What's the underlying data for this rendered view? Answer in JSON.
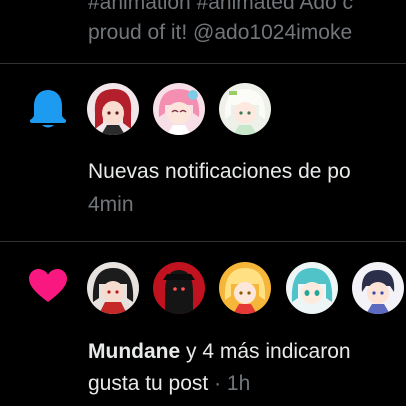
{
  "previous_item": {
    "line1": "#animation #animated Ado c",
    "line2": "proud of it! @ado1024imoke"
  },
  "notifications": [
    {
      "type": "new-posts",
      "icon": "bell-icon",
      "icon_color": "#1d9bf0",
      "text": "Nuevas notificaciones de po",
      "time": "4min",
      "avatars": [
        {
          "name": "red-hair-avatar",
          "bg": "#f1e6ea"
        },
        {
          "name": "pink-hair-avatar",
          "bg": "#f7dfe7"
        },
        {
          "name": "white-hair-avatar",
          "bg": "#eef1ea"
        }
      ]
    },
    {
      "type": "likes",
      "icon": "heart-icon",
      "icon_color": "#f91880",
      "user": "Mundane",
      "action_line1": " y 4 más indicaron",
      "action_line2": "gusta tu post",
      "separator": " · ",
      "time": "1h",
      "avatars": [
        {
          "name": "dark-hair-avatar",
          "bg": "#e8e2df"
        },
        {
          "name": "dark-figure-avatar",
          "bg": "#c1121f"
        },
        {
          "name": "blonde-avatar",
          "bg": "#f6b63a"
        },
        {
          "name": "teal-hair-avatar",
          "bg": "#eef5f6"
        },
        {
          "name": "boy-avatar",
          "bg": "#f3f3f7"
        }
      ]
    }
  ]
}
